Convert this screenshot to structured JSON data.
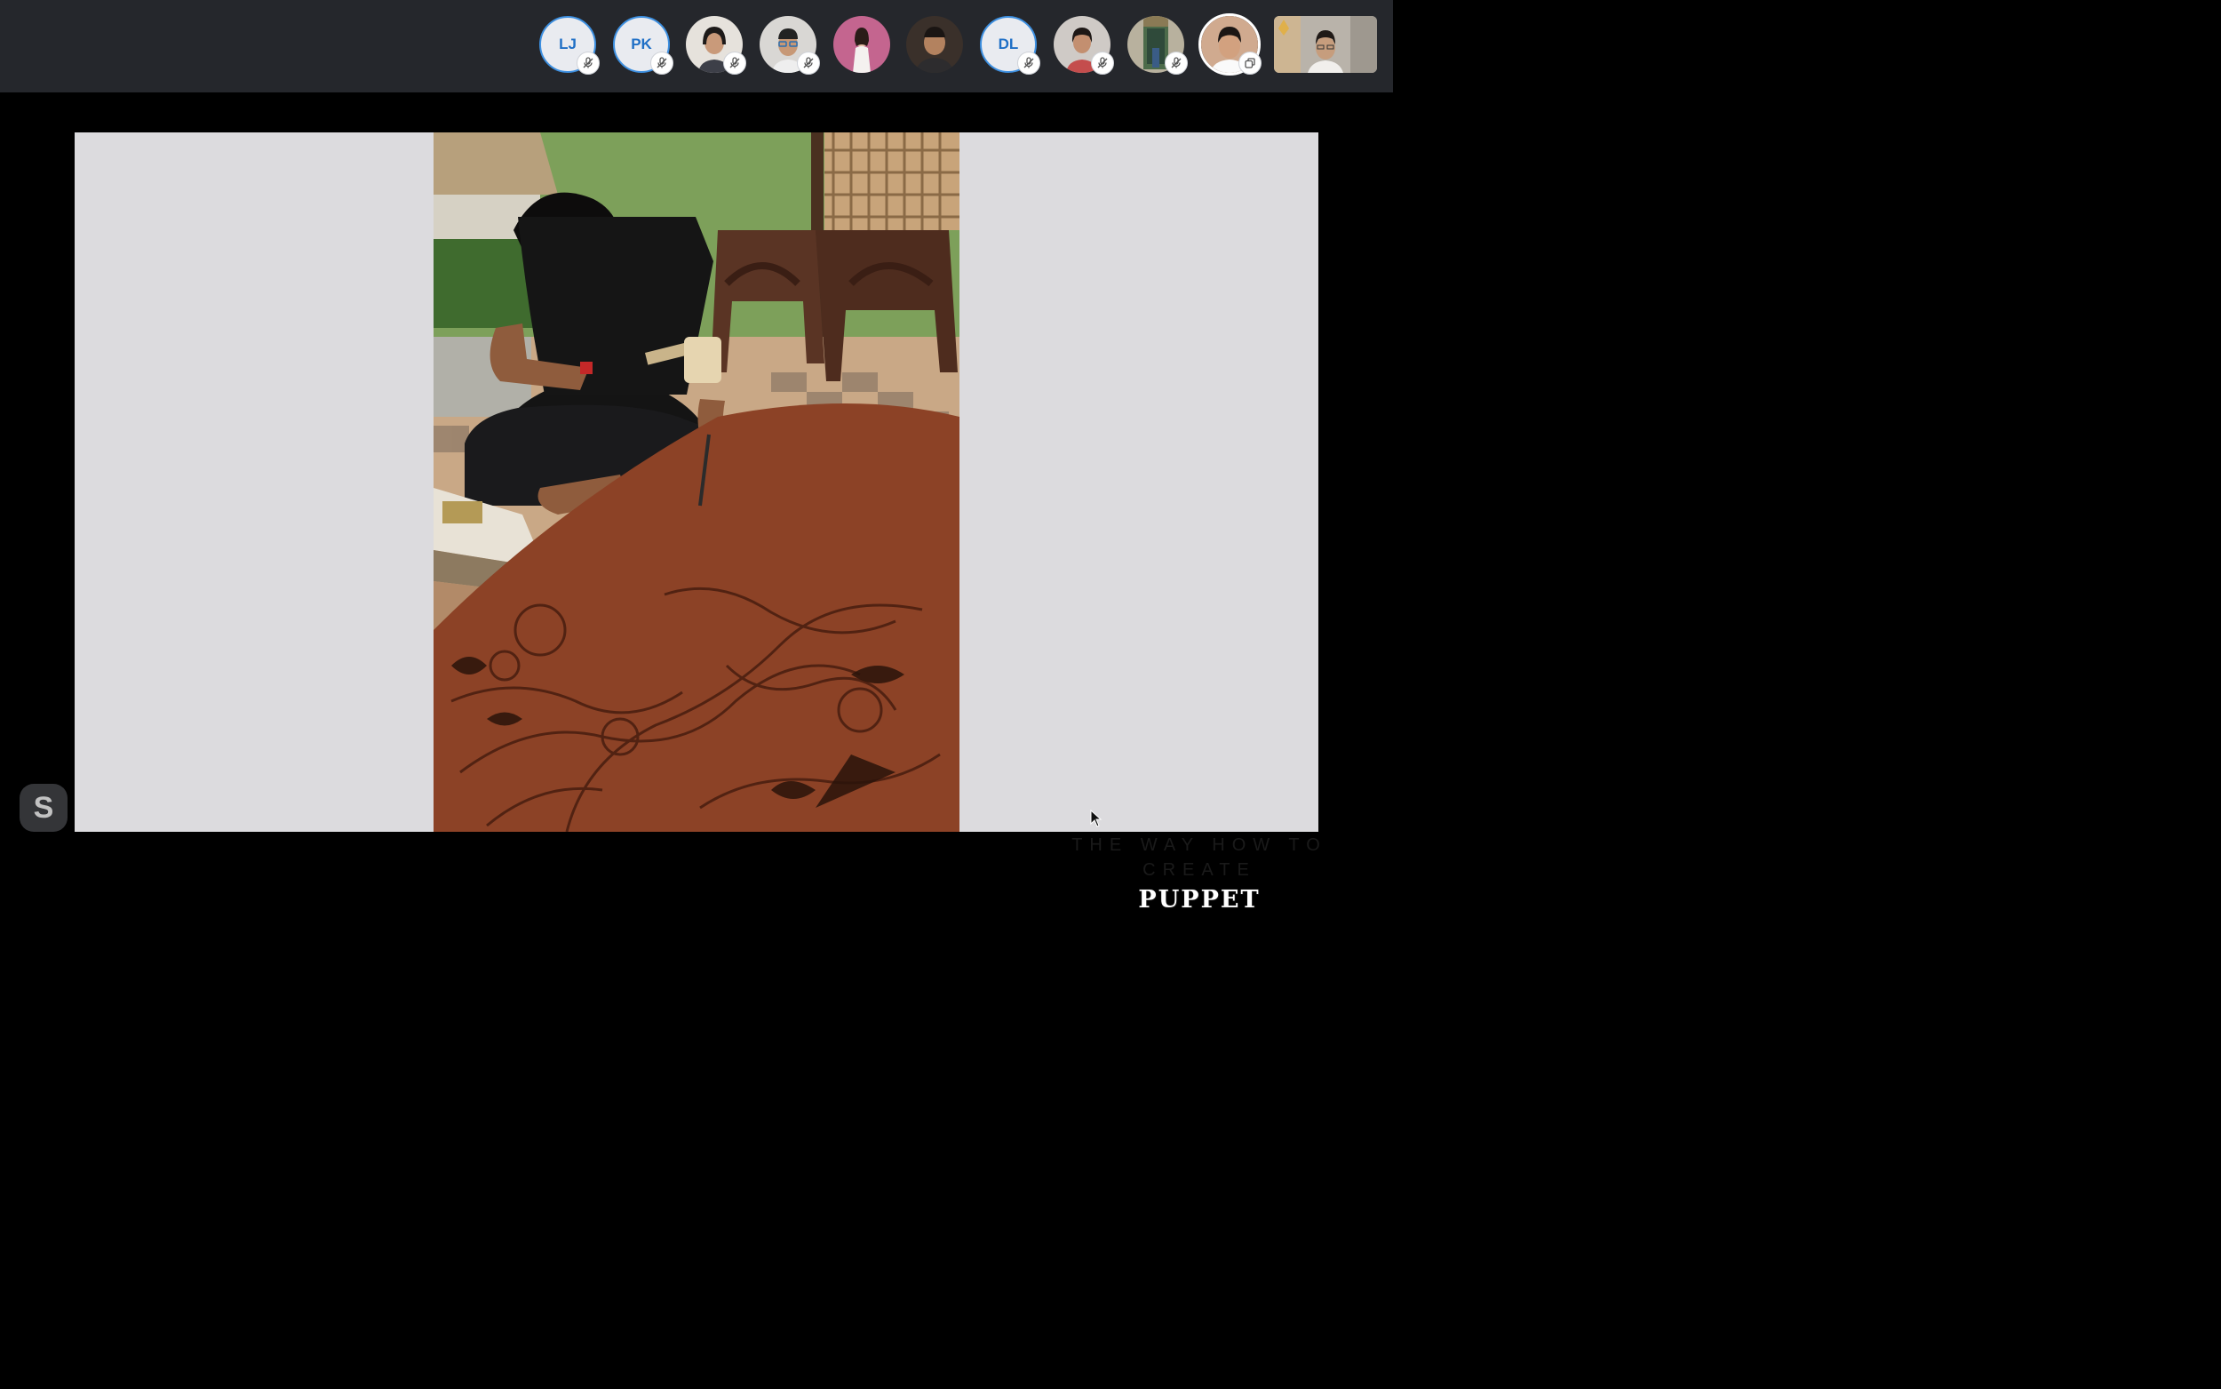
{
  "participants": [
    {
      "initials": "LJ",
      "muted": true
    },
    {
      "initials": "PK",
      "muted": true
    },
    {
      "initials": "",
      "muted": true
    },
    {
      "initials": "",
      "muted": true
    },
    {
      "initials": "",
      "muted": false
    },
    {
      "initials": "",
      "muted": false
    },
    {
      "initials": "DL",
      "muted": true
    },
    {
      "initials": "",
      "muted": true
    },
    {
      "initials": "",
      "muted": true
    },
    {
      "initials": "",
      "muted": false,
      "speaking": true
    }
  ],
  "slide": {
    "caption_line1": "THE WAY HOW TO",
    "caption_line2": "CREATE",
    "caption_line3": "PUPPET"
  },
  "app": {
    "logo_letter": "S"
  },
  "colors": {
    "topbar": "#25272c",
    "slide_bg": "#dcdbde",
    "initials_text": "#1f6fc6"
  }
}
